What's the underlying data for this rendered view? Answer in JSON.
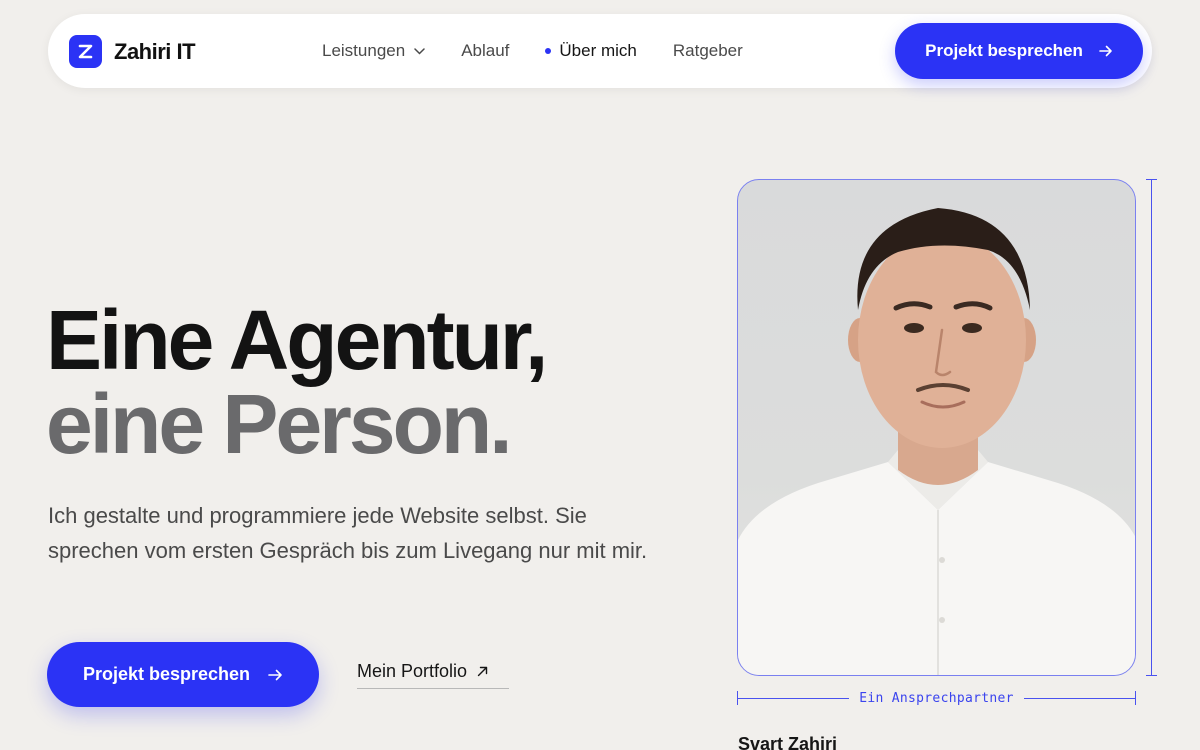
{
  "brand": {
    "name": "Zahiri IT",
    "logo_letter": "Z",
    "accent": "#2b33f5"
  },
  "nav": {
    "items": [
      {
        "label": "Leistungen",
        "has_dropdown": true,
        "active": false
      },
      {
        "label": "Ablauf",
        "active": false
      },
      {
        "label": "Über mich",
        "active": true
      },
      {
        "label": "Ratgeber",
        "active": false
      }
    ],
    "cta_label": "Projekt besprechen",
    "cta_icon": "arrow-right-icon"
  },
  "hero": {
    "headline_line1": "Eine Agentur,",
    "headline_line2": "eine Person.",
    "lead": "Ich gestalte und programmiere jede Website selbst. Sie sprechen vom ersten Gespräch bis zum Livegang nur mit mir.",
    "cta_label": "Projekt besprechen",
    "cta_icon": "arrow-right-icon",
    "secondary_label": "Mein Portfolio",
    "secondary_icon": "arrow-up-right-icon"
  },
  "profile": {
    "dimension_label": "Ein Ansprechpartner",
    "name": "Svart Zahiri"
  }
}
